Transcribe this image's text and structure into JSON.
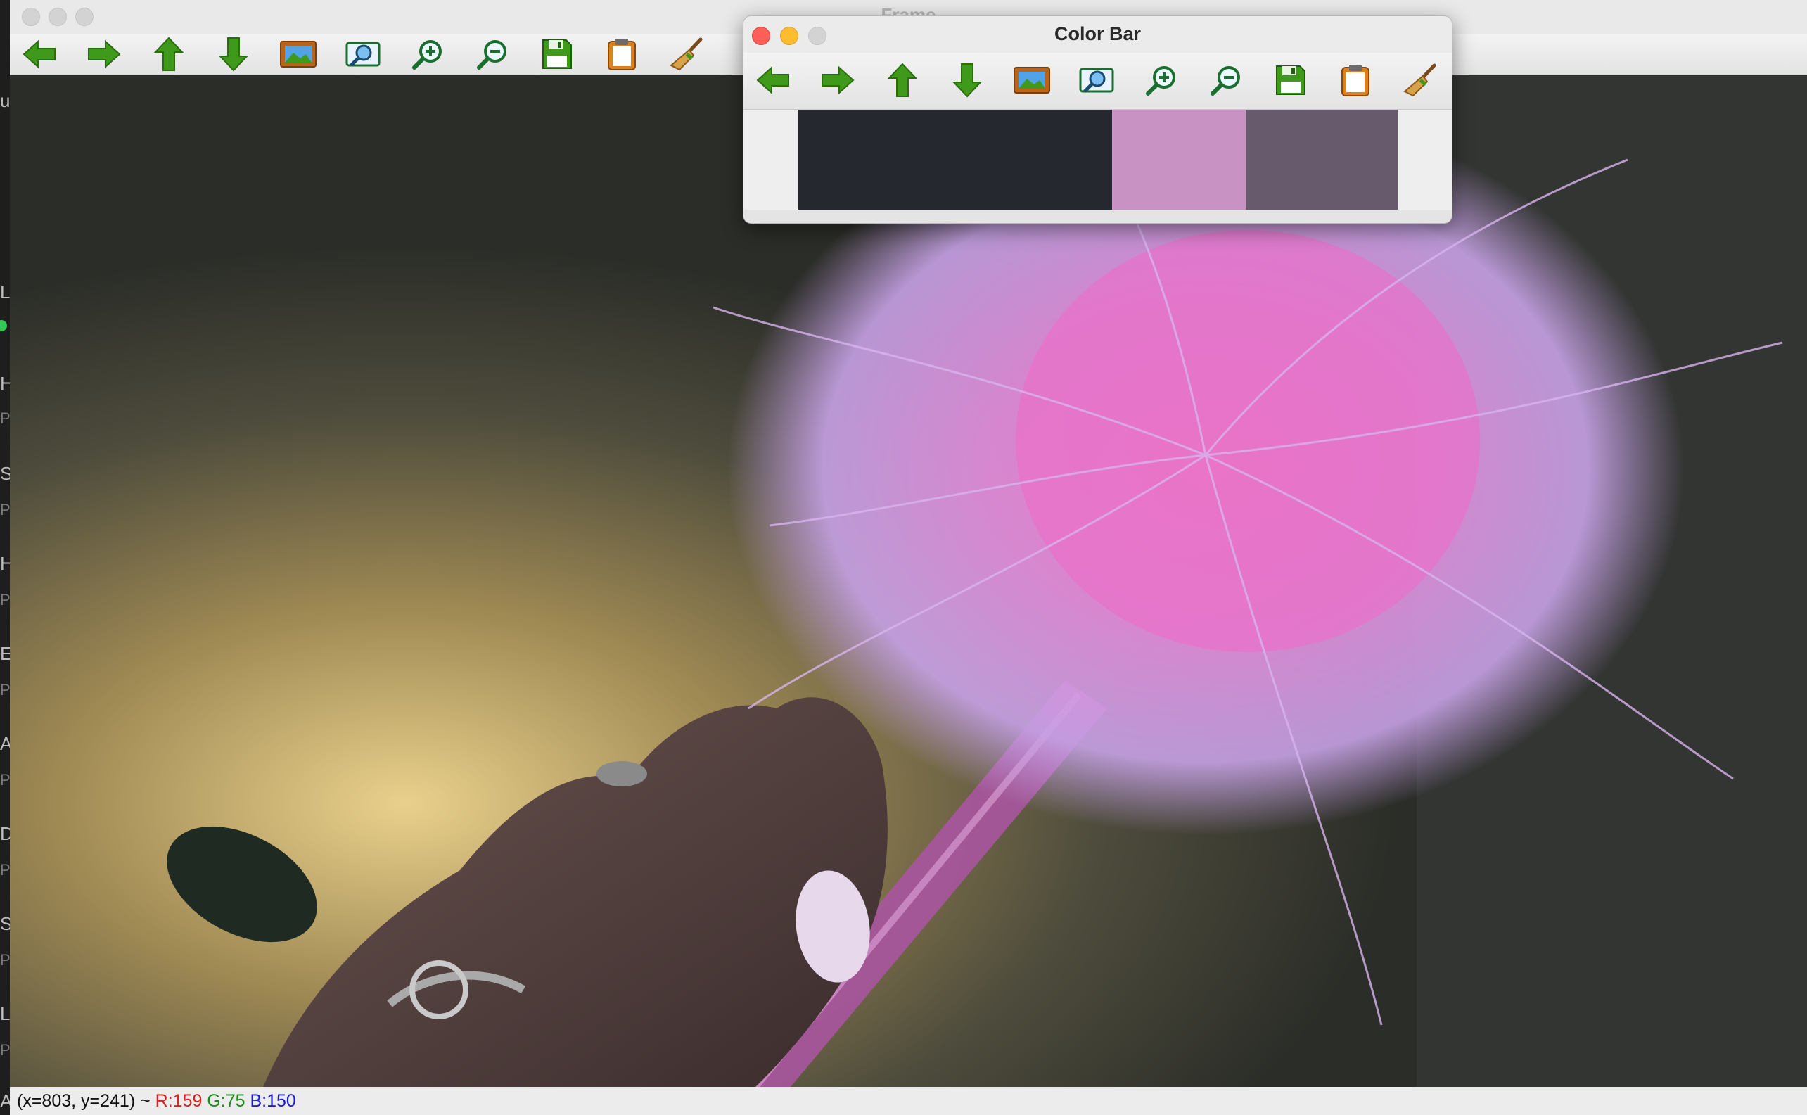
{
  "frame_window": {
    "title": "Frame",
    "toolbar": [
      {
        "name": "back-arrow-icon",
        "tooltip": "Pan left"
      },
      {
        "name": "forward-arrow-icon",
        "tooltip": "Pan right"
      },
      {
        "name": "up-arrow-icon",
        "tooltip": "Pan up"
      },
      {
        "name": "down-arrow-icon",
        "tooltip": "Pan down"
      },
      {
        "name": "image-fit-icon",
        "tooltip": "Zoom to fit"
      },
      {
        "name": "zoom-region-icon",
        "tooltip": "Zoom region"
      },
      {
        "name": "zoom-in-icon",
        "tooltip": "Zoom in"
      },
      {
        "name": "zoom-out-icon",
        "tooltip": "Zoom out"
      },
      {
        "name": "save-icon",
        "tooltip": "Save"
      },
      {
        "name": "clipboard-icon",
        "tooltip": "Copy to clipboard"
      },
      {
        "name": "broom-icon",
        "tooltip": "Clear"
      }
    ],
    "status": {
      "coords": "(x=803, y=241) ~",
      "r": "R:159",
      "g": "G:75",
      "b": "B:150"
    }
  },
  "color_bar_window": {
    "title": "Color Bar",
    "swatches": [
      {
        "color": "#25292f",
        "fraction": 0.523
      },
      {
        "color": "#c892c2",
        "fraction": 0.223
      },
      {
        "color": "#675a6c",
        "fraction": 0.254
      }
    ]
  },
  "background_app": {
    "labels": [
      "u",
      "Li",
      "H",
      "Pl",
      "S",
      "Pl",
      "Ha",
      "Pl",
      "Er",
      "Pl",
      "Ar",
      "Pl",
      "D",
      "Pl",
      "Sk",
      "Pl",
      "Lo",
      "Pl",
      "A"
    ]
  },
  "colors": {
    "accent_green": "#3f9a1c",
    "close_red": "#ff5f57",
    "minimize_yellow": "#febc2e",
    "inactive_grey": "#d3d3d3"
  }
}
